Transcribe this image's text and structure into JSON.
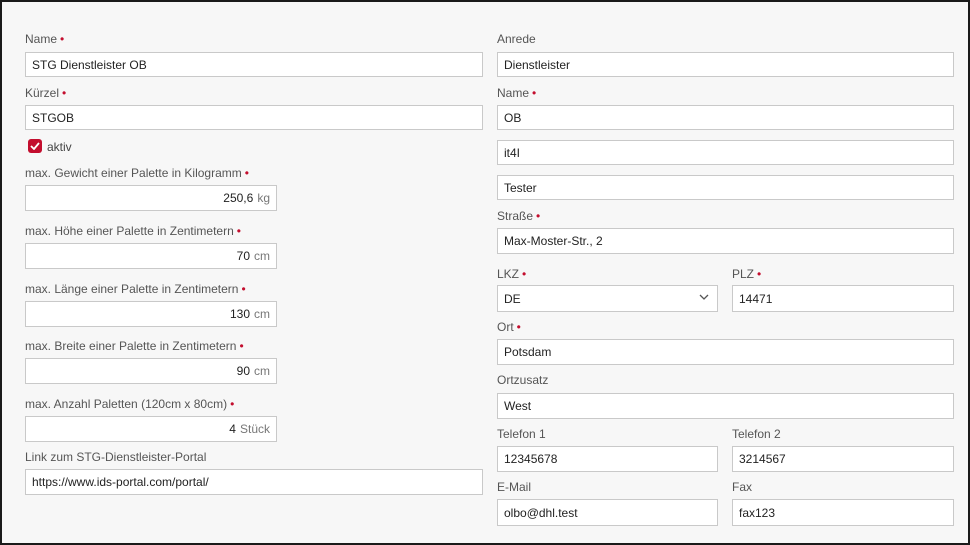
{
  "left": {
    "name": {
      "label": "Name",
      "value": "STG Dienstleister OB"
    },
    "kuerzel": {
      "label": "Kürzel",
      "value": "STGOB"
    },
    "aktiv": {
      "label": "aktiv"
    },
    "gewicht": {
      "label": "max. Gewicht einer Palette in Kilogramm",
      "value": "250,6",
      "unit": "kg"
    },
    "hoehe": {
      "label": "max. Höhe einer Palette in Zentimetern",
      "value": "70",
      "unit": "cm"
    },
    "laenge": {
      "label": "max. Länge einer Palette in Zentimetern",
      "value": "130",
      "unit": "cm"
    },
    "breite": {
      "label": "max. Breite einer Palette in Zentimetern",
      "value": "90",
      "unit": "cm"
    },
    "anzahl": {
      "label": "max. Anzahl Paletten (120cm x 80cm)",
      "value": "4",
      "unit": "Stück"
    },
    "link": {
      "label": "Link zum STG-Dienstleister-Portal",
      "value": "https://www.ids-portal.com/portal/"
    }
  },
  "right": {
    "anrede": {
      "label": "Anrede",
      "value": "Dienstleister"
    },
    "name": {
      "label": "Name",
      "value": "OB"
    },
    "name2": {
      "value": "it4I"
    },
    "name3": {
      "value": "Tester"
    },
    "strasse": {
      "label": "Straße",
      "value": "Max-Moster-Str., 2"
    },
    "lkz": {
      "label": "LKZ",
      "value": "DE"
    },
    "plz": {
      "label": "PLZ",
      "value": "14471"
    },
    "ort": {
      "label": "Ort",
      "value": "Potsdam"
    },
    "ortzusatz": {
      "label": "Ortzusatz",
      "value": "West"
    },
    "telefon1": {
      "label": "Telefon 1",
      "value": "12345678"
    },
    "telefon2": {
      "label": "Telefon 2",
      "value": "3214567"
    },
    "email": {
      "label": "E-Mail",
      "value": "olbo@dhl.test"
    },
    "fax": {
      "label": "Fax",
      "value": "fax123"
    }
  },
  "required_marker": "•",
  "colors": {
    "accent": "#c30e2e",
    "border": "#c9c9c9",
    "background": "#f7f7f7"
  }
}
